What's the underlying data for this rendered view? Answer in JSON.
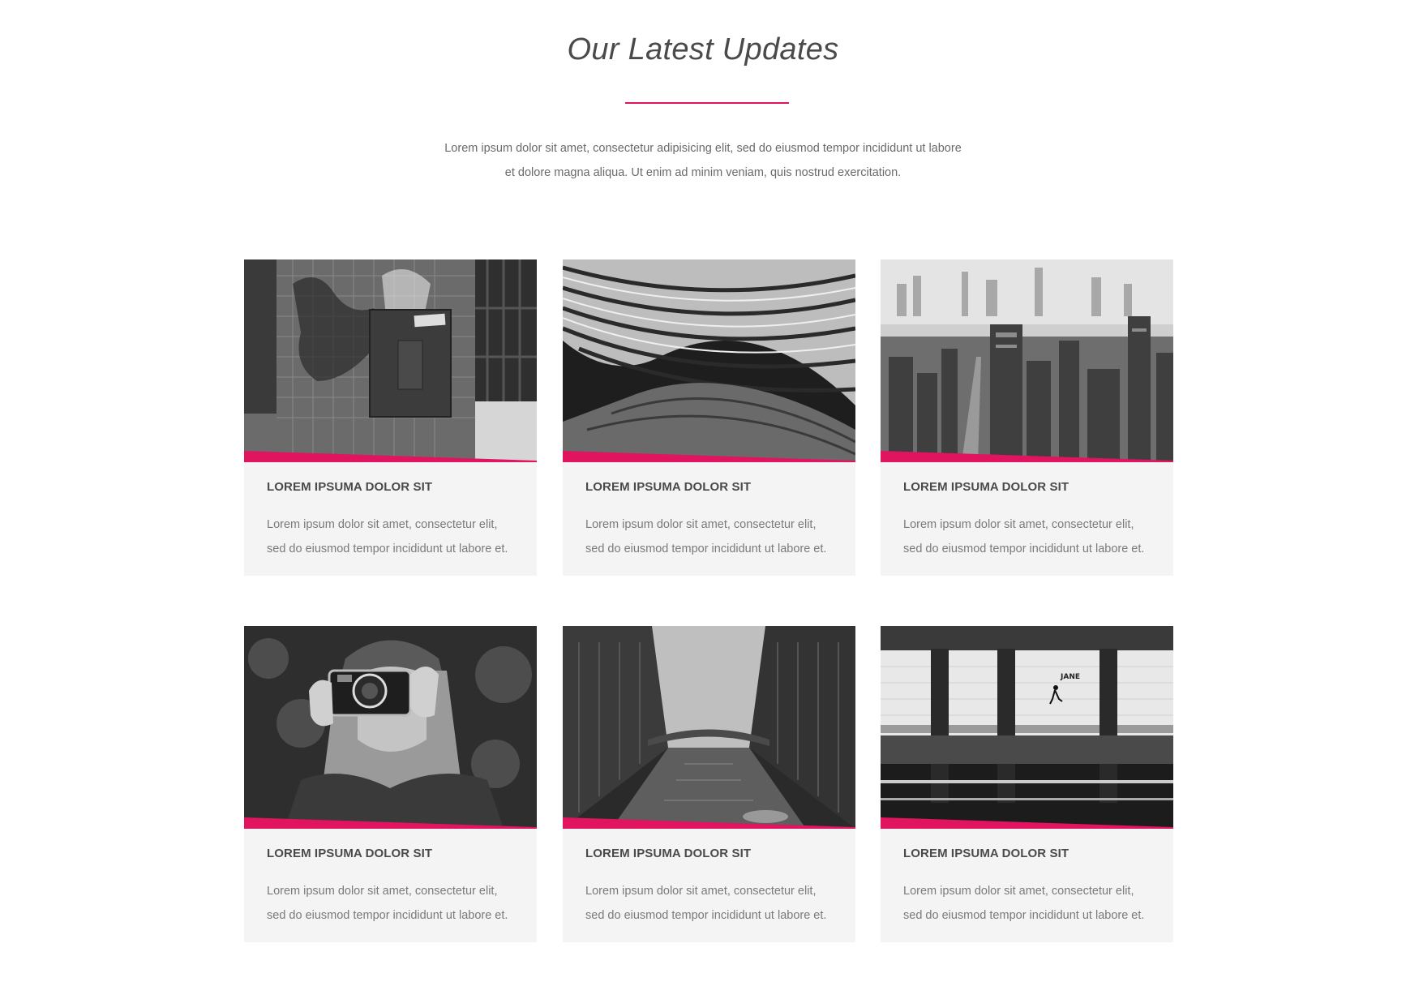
{
  "section": {
    "title": "Our Latest Updates",
    "intro_line1": "Lorem ipsum dolor sit amet, consectetur adipisicing elit, sed do eiusmod tempor incididunt ut labore",
    "intro_line2": "et dolore magna aliqua. Ut enim ad minim veniam, quis nostrud exercitation.",
    "accent_color": "#e0145f"
  },
  "cards": [
    {
      "image": "alarm-box-graffiti-photo",
      "title": "LOREM IPSUMA DOLOR SIT",
      "desc_line1": "Lorem ipsum dolor sit amet, consectetur elit,",
      "desc_line2": "sed do eiusmod tempor incididunt ut labore et."
    },
    {
      "image": "curved-architecture-photo",
      "title": "LOREM IPSUMA DOLOR SIT",
      "desc_line1": "Lorem ipsum dolor sit amet, consectetur elit,",
      "desc_line2": "sed do eiusmod tempor incididunt ut labore et."
    },
    {
      "image": "foggy-city-skyline-photo",
      "title": "LOREM IPSUMA DOLOR SIT",
      "desc_line1": "Lorem ipsum dolor sit amet, consectetur elit,",
      "desc_line2": "sed do eiusmod tempor incididunt ut labore et."
    },
    {
      "image": "woman-with-camera-photo",
      "title": "LOREM IPSUMA DOLOR SIT",
      "desc_line1": "Lorem ipsum dolor sit amet, consectetur elit,",
      "desc_line2": "sed do eiusmod tempor incididunt ut labore et."
    },
    {
      "image": "canal-bridge-photo",
      "title": "LOREM IPSUMA DOLOR SIT",
      "desc_line1": "Lorem ipsum dolor sit amet, consectetur elit,",
      "desc_line2": "sed do eiusmod tempor incididunt ut labore et."
    },
    {
      "image": "subway-station-photo",
      "title": "LOREM IPSUMA DOLOR SIT",
      "desc_line1": "Lorem ipsum dolor sit amet, consectetur elit,",
      "desc_line2": "sed do eiusmod tempor incididunt ut labore et.",
      "sign_text": "JANE"
    }
  ]
}
